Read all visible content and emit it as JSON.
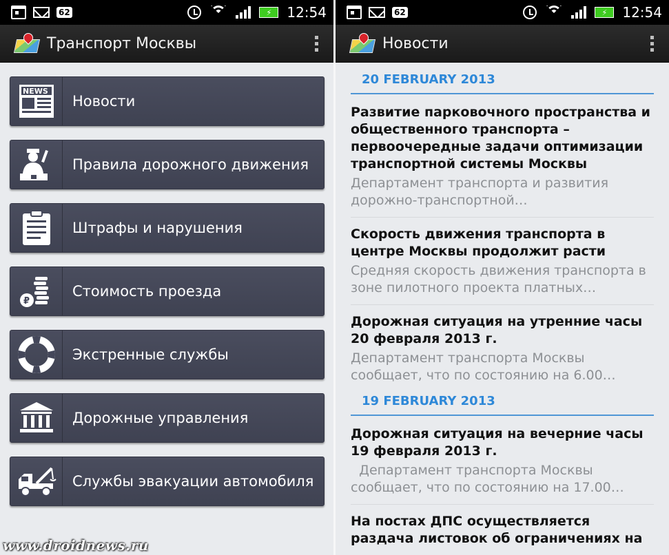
{
  "status_bar": {
    "notification_count": "62",
    "time": "12:54"
  },
  "left_screen": {
    "title": "Транспорт Москвы",
    "menu": [
      {
        "label": "Новости",
        "icon": "newspaper-icon"
      },
      {
        "label": "Правила дорожного движения",
        "icon": "traffic-officer-icon"
      },
      {
        "label": "Штрафы и нарушения",
        "icon": "clipboard-icon"
      },
      {
        "label": "Стоимость проезда",
        "icon": "coins-icon"
      },
      {
        "label": "Экстренные службы",
        "icon": "lifebuoy-icon"
      },
      {
        "label": "Дорожные управления",
        "icon": "building-columns-icon"
      },
      {
        "label": "Службы эвакуации автомобиля",
        "icon": "tow-truck-icon"
      }
    ]
  },
  "right_screen": {
    "title": "Новости",
    "sections": [
      {
        "date": "20 FEBRUARY 2013",
        "items": [
          {
            "title": "Развитие парковочного пространства и общественного транспорта – первоочередные задачи оптимизации транспортной системы Москвы",
            "desc": "Департамент транспорта и развития дорожно-транспортной…"
          },
          {
            "title": "Скорость движения транспорта в центре Москвы продолжит расти",
            "desc": "Средняя скорость движения транспорта в зоне пилотного проекта платных…"
          },
          {
            "title": "Дорожная ситуация на утренние часы 20 февраля 2013 г.",
            "desc": "Департамент транспорта Москвы сообщает, что по состоянию на 6.00…"
          }
        ]
      },
      {
        "date": "19 FEBRUARY 2013",
        "items": [
          {
            "title": "Дорожная ситуация на вечерние часы 19 февраля 2013 г.",
            "desc": "  Департамент транспорта Москвы сообщает, что по состоянию на 17.00…"
          },
          {
            "title": "На постах ДПС осуществляется раздача листовок об ограничениях на",
            "desc": ""
          }
        ]
      }
    ]
  },
  "watermark": "www.droidnews.ru",
  "colors": {
    "accent_blue": "#2e88d8",
    "menu_tile": "#44475a",
    "battery_green": "#3ecb20"
  }
}
